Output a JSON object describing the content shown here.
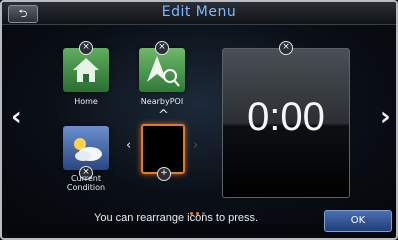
{
  "header": {
    "title": "Edit Menu",
    "back_icon": "back-arrow-icon"
  },
  "tiles": [
    {
      "label": "Home",
      "icon": "home-icon"
    },
    {
      "label": "NearbyPOI",
      "icon": "map-search-icon"
    },
    {
      "label": "Current Condition",
      "icon": "weather-icon"
    }
  ],
  "clock": {
    "time": "0:00"
  },
  "footer": {
    "hint": "You can rearrange icons to press.",
    "ok_label": "OK"
  },
  "controls": {
    "left_arrow": "‹",
    "right_arrow": "›",
    "up_arrow": "^",
    "remove_symbol": "×",
    "add_symbol": "+"
  },
  "colors": {
    "title": "#7fb9ff",
    "selection": "#e07a2a",
    "ok_button": "#2f56a0"
  }
}
